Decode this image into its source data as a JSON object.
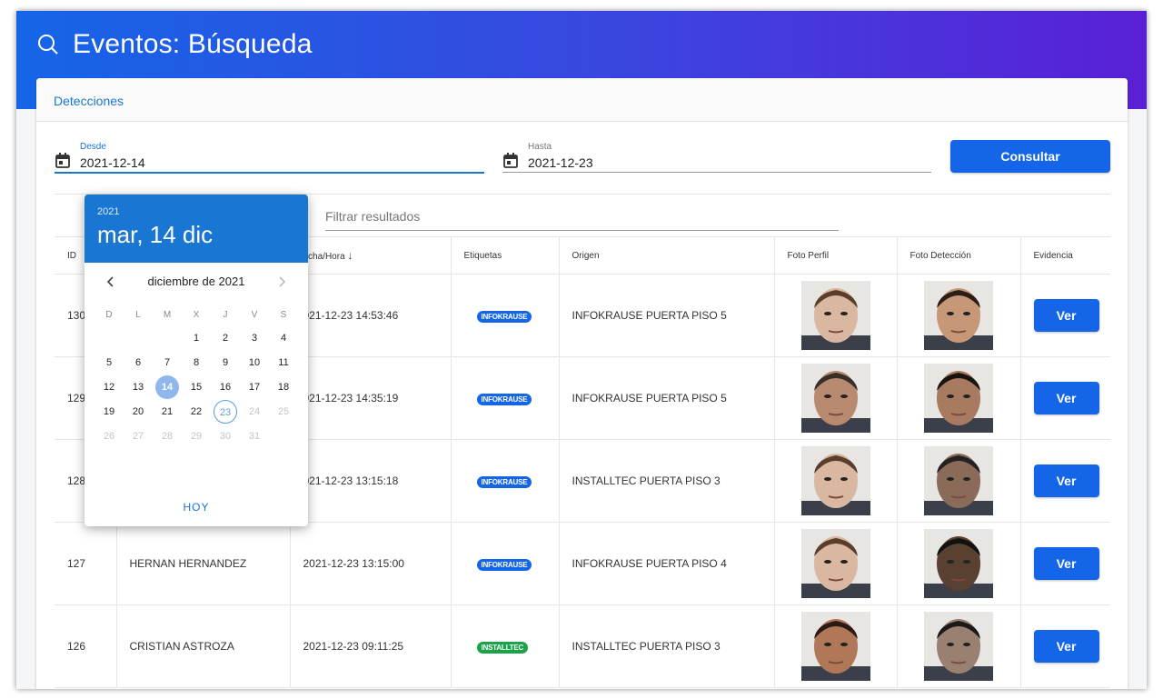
{
  "header": {
    "title": "Eventos: Búsqueda",
    "icon": "search-icon"
  },
  "card": {
    "tab": "Detecciones"
  },
  "form": {
    "desde_label": "Desde",
    "desde_value": "2021-12-14",
    "hasta_label": "Hasta",
    "hasta_value": "2021-12-23",
    "consultar_label": "Consultar",
    "filter_placeholder": "Filtrar resultados"
  },
  "table": {
    "columns": [
      "ID",
      "",
      "echa/Hora",
      "Etiquetas",
      "Origen",
      "Foto Perfil",
      "Foto Detección",
      "Evidencia"
    ],
    "sort_indicator": "↓",
    "ver_label": "Ver",
    "rows": [
      {
        "id": "130",
        "nombre": "",
        "fecha": "021-12-23 14:53:46",
        "tag": "INFOKRAUSE",
        "origen": "INFOKRAUSE PUERTA PISO 5"
      },
      {
        "id": "129",
        "nombre": "",
        "fecha": "021-12-23 14:35:19",
        "tag": "INFOKRAUSE",
        "origen": "INFOKRAUSE PUERTA PISO 5"
      },
      {
        "id": "128",
        "nombre": "",
        "fecha": "021-12-23 13:15:18",
        "tag": "INFOKRAUSE",
        "origen": "INSTALLTEC PUERTA PISO 3"
      },
      {
        "id": "127",
        "nombre": "HERNAN HERNANDEZ",
        "fecha": "2021-12-23 13:15:00",
        "tag": "INFOKRAUSE",
        "origen": "INFOKRAUSE PUERTA PISO 4"
      },
      {
        "id": "126",
        "nombre": "CRISTIAN ASTROZA",
        "fecha": "2021-12-23 09:11:25",
        "tag": "INSTALLTEC",
        "origen": "INSTALLTEC PUERTA PISO 3"
      }
    ]
  },
  "datepicker": {
    "year": "2021",
    "date": "mar, 14 dic",
    "month_label": "diciembre de 2021",
    "weekdays": [
      "D",
      "L",
      "M",
      "X",
      "J",
      "V",
      "S"
    ],
    "weeks": [
      [
        "",
        "",
        "",
        "1",
        "2",
        "3",
        "4"
      ],
      [
        "5",
        "6",
        "7",
        "8",
        "9",
        "10",
        "11"
      ],
      [
        "12",
        "13",
        "14",
        "15",
        "16",
        "17",
        "18"
      ],
      [
        "19",
        "20",
        "21",
        "22",
        "23",
        "24",
        "25"
      ],
      [
        "26",
        "27",
        "28",
        "29",
        "30",
        "31",
        ""
      ]
    ],
    "selected": "14",
    "today": "23",
    "today_button": "HOY"
  },
  "colors": {
    "primary": "#1565e8",
    "tag_infokrause": "#1565e8",
    "tag_installtec": "#1aa34a"
  }
}
